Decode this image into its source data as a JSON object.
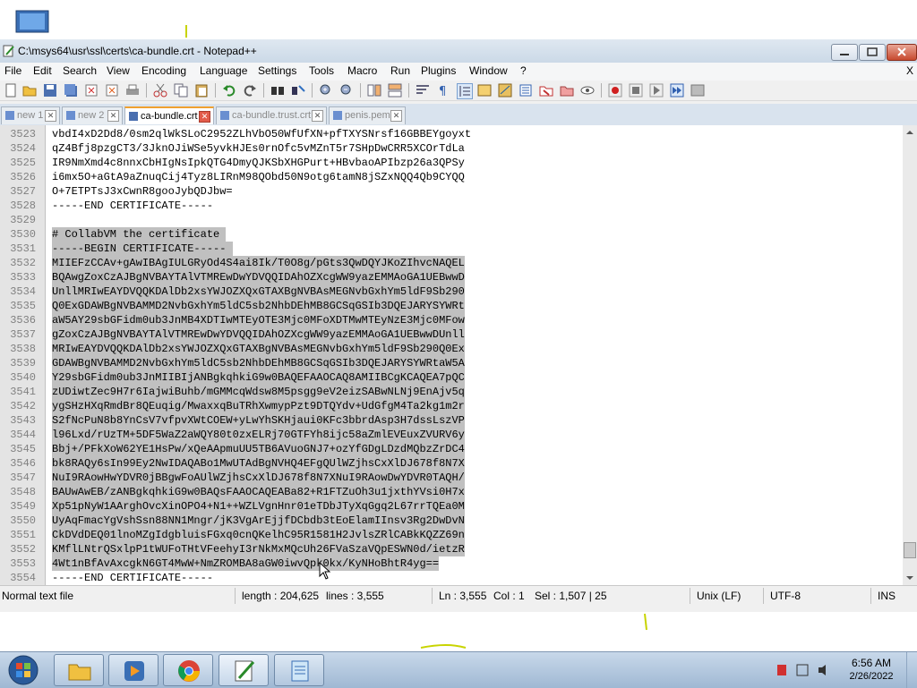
{
  "window": {
    "title": "C:\\msys64\\usr\\ssl\\certs\\ca-bundle.crt - Notepad++"
  },
  "menu": {
    "items": [
      "File",
      "Edit",
      "Search",
      "View",
      "Encoding",
      "Language",
      "Settings",
      "Tools",
      "Macro",
      "Run",
      "Plugins",
      "Window",
      "?"
    ],
    "close_x": "X"
  },
  "tabs": [
    {
      "label": "new 1",
      "active": false
    },
    {
      "label": "new 2",
      "active": false
    },
    {
      "label": "ca-bundle.crt",
      "active": true
    },
    {
      "label": "ca-bundle.trust.crt",
      "active": false
    },
    {
      "label": "penis.pem",
      "active": false
    }
  ],
  "editor": {
    "lines": [
      {
        "num": "3523",
        "text": "vbdI4xD2Dd8/0sm2qlWkSLoC2952ZLhVbO50WfUfXN+pfTXYSNrsf16GBBEYgoyxt",
        "sel": false
      },
      {
        "num": "3524",
        "text": "qZ4Bfj8pzgCT3/3JknOJiWSe5yvkHJEs0rnOfc5vMZnT5r7SHpDwCRR5XCOrTdLa",
        "sel": false
      },
      {
        "num": "3525",
        "text": "IR9NmXmd4c8nnxCbHIgNsIpkQTG4DmyQJKSbXHGPurt+HBvbaoAPIbzp26a3QPSy",
        "sel": false
      },
      {
        "num": "3526",
        "text": "i6mx5O+aGtA9aZnuqCij4Tyz8LIRnM98QObd50N9otg6tamN8jSZxNQQ4Qb9CYQQ",
        "sel": false
      },
      {
        "num": "3527",
        "text": "O+7ETPTsJ3xCwnR8gooJybQDJbw=",
        "sel": false
      },
      {
        "num": "3528",
        "text": "-----END CERTIFICATE-----",
        "sel": false
      },
      {
        "num": "3529",
        "text": "",
        "sel": false
      },
      {
        "num": "3530",
        "text": "# CollabVM the certificate ",
        "sel": true
      },
      {
        "num": "3531",
        "text": "-----BEGIN CERTIFICATE----- ",
        "sel": true
      },
      {
        "num": "3532",
        "text": "MIIEFzCCAv+gAwIBAgIULGRyOd4S4ai8Ik/T0O8g/pGts3QwDQYJKoZIhvcNAQEL",
        "sel": true
      },
      {
        "num": "3533",
        "text": "BQAwgZoxCzAJBgNVBAYTAlVTMREwDwYDVQQIDAhOZXcgWW9yazEMMAoGA1UEBwwD",
        "sel": true
      },
      {
        "num": "3534",
        "text": "UnllMRIwEAYDVQQKDAlDb2xsYWJOZXQxGTAXBgNVBAsMEGNvbGxhYm5ldF9Sb290",
        "sel": true
      },
      {
        "num": "3535",
        "text": "Q0ExGDAWBgNVBAMMD2NvbGxhYm5ldC5sb2NhbDEhMB8GCSqGSIb3DQEJARYSYWRt",
        "sel": true
      },
      {
        "num": "3536",
        "text": "aW5AY29sbGFidm0ub3JnMB4XDTIwMTEyOTE3Mjc0MFoXDTMwMTEyNzE3Mjc0MFow",
        "sel": true
      },
      {
        "num": "3537",
        "text": "gZoxCzAJBgNVBAYTAlVTMREwDwYDVQQIDAhOZXcgWW9yazEMMAoGA1UEBwwDUnll",
        "sel": true
      },
      {
        "num": "3538",
        "text": "MRIwEAYDVQQKDAlDb2xsYWJOZXQxGTAXBgNVBAsMEGNvbGxhYm5ldF9Sb290Q0Ex",
        "sel": true
      },
      {
        "num": "3539",
        "text": "GDAWBgNVBAMMD2NvbGxhYm5ldC5sb2NhbDEhMB8GCSqGSIb3DQEJARYSYWRtaW5A",
        "sel": true
      },
      {
        "num": "3540",
        "text": "Y29sbGFidm0ub3JnMIIBIjANBgkqhkiG9w0BAQEFAAOCAQ8AMIIBCgKCAQEA7pQC",
        "sel": true
      },
      {
        "num": "3541",
        "text": "zUDiwtZec9H7r6IajwiBuhb/mGMMcqWdsw8M5psgg9eV2eizSABwNLNj9EnAjv5q",
        "sel": true
      },
      {
        "num": "3542",
        "text": "ygSHzHXqRmdBr8QEuqig/MwaxxqBuTRhXwmypPzt9DTQYdv+UdGfgM4Ta2kg1m2r",
        "sel": true
      },
      {
        "num": "3543",
        "text": "S2fNcPuN8b8YnCsV7vfpvXWtCOEW+yLwYhSKHjaui0KFc3bbrdAsp3H7dssLszVP",
        "sel": true
      },
      {
        "num": "3544",
        "text": "l96Lxd/rUzTM+5DF5WaZ2aWQY80t0zxELRj70GTFYh8ijc58aZmlEVEuxZVURV6y",
        "sel": true
      },
      {
        "num": "3545",
        "text": "Bbj+/PFkXoW62YE1HsPw/xQeAApmuUU5TB6AVuoGNJ7+ozYfGDgLDzdMQbzZrDC4",
        "sel": true
      },
      {
        "num": "3546",
        "text": "bk8RAQy6sIn99Ey2NwIDAQABo1MwUTAdBgNVHQ4EFgQUlWZjhsCxXlDJ678f8N7X",
        "sel": true
      },
      {
        "num": "3547",
        "text": "NuI9RAowHwYDVR0jBBgwFoAUlWZjhsCxXlDJ678f8N7XNuI9RAowDwYDVR0TAQH/",
        "sel": true
      },
      {
        "num": "3548",
        "text": "BAUwAwEB/zANBgkqhkiG9w0BAQsFAAOCAQEABa82+R1FTZuOh3u1jxthYVsi0H7x",
        "sel": true
      },
      {
        "num": "3549",
        "text": "Xp51pNyW1AArghOvcXinOPO4+N1++WZLVgnHnr01eTDbJTyXqGgq2L67rrTQEa0M",
        "sel": true
      },
      {
        "num": "3550",
        "text": "UyAqFmacYgVshSsn88NN1Mngr/jK3VgArEjjfDCbdb3tEoElamIInsv3Rg2DwDvN",
        "sel": true
      },
      {
        "num": "3551",
        "text": "CkDVdDEQ01lnoMZgIdgbluisFGxq0cnQKelhC95R1581H2JvlsZRlCABkKQZZ69n",
        "sel": true
      },
      {
        "num": "3552",
        "text": "KMflLNtrQSxlpP1tWUFoTHtVFeehyI3rNkMxMQcUh26FVaSzaVQpESWN0d/ietzR",
        "sel": true
      },
      {
        "num": "3553",
        "text": "4Wt1nBfAvAxcgkN6GT4MwW+NmZROMBA8aGW0iwvQpk0kx/KyNHoBhtR4yg==",
        "sel": true
      },
      {
        "num": "3554",
        "text": "-----END CERTIFICATE-----",
        "sel": false
      }
    ]
  },
  "status": {
    "filetype": "Normal text file",
    "length": "length : 204,625",
    "lines": "lines : 3,555",
    "ln": "Ln : 3,555",
    "col": "Col : 1",
    "sel": "Sel : 1,507 | 25",
    "eol": "Unix (LF)",
    "encoding": "UTF-8",
    "mode": "INS"
  },
  "taskbar": {
    "apps": [
      "windows-explorer",
      "media-player",
      "chrome",
      "notepad-plus-plus",
      "notepad"
    ],
    "time": "6:56 AM",
    "date": "2/26/2022"
  },
  "colors": {
    "selection": "#c0c0c0",
    "gutter": "#e4e4e4",
    "accent_tab": "#f0a030",
    "taskbar": "#b2c7de"
  }
}
